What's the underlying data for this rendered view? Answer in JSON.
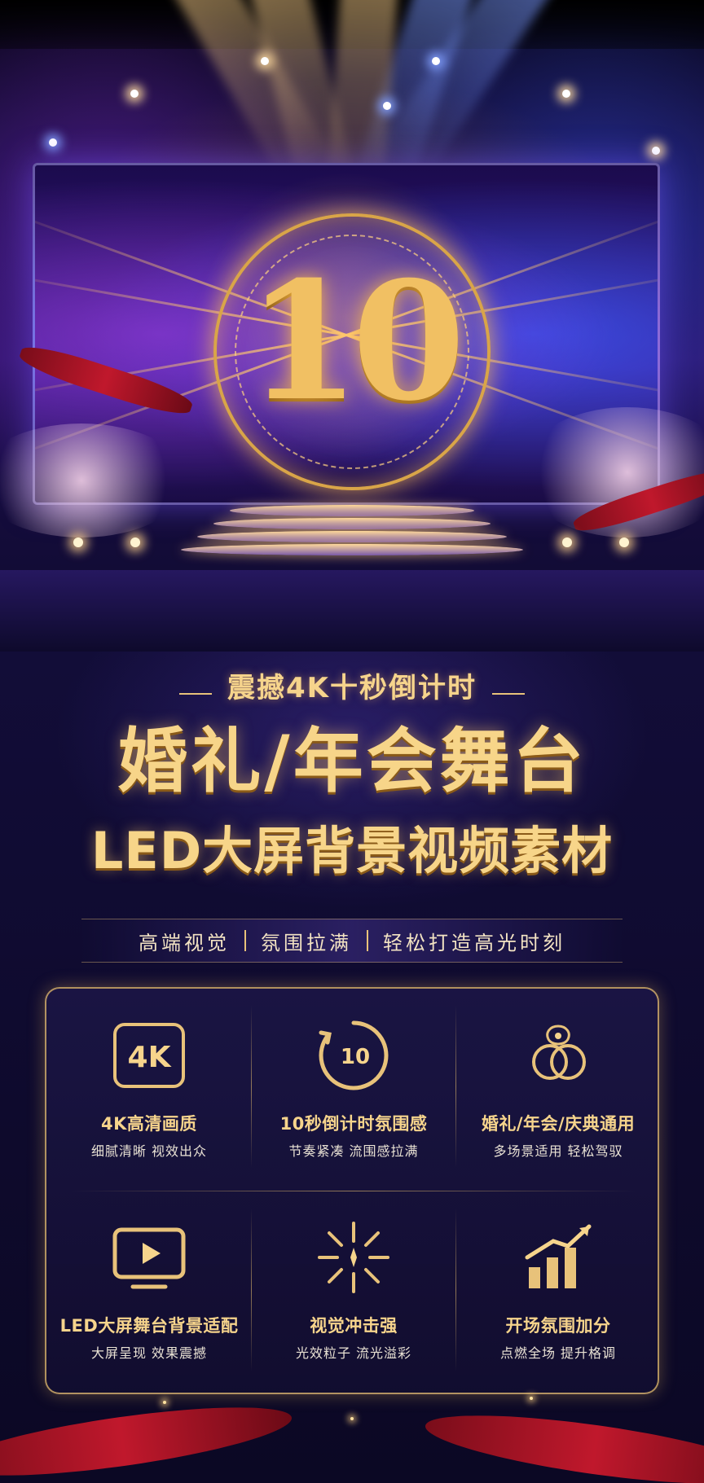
{
  "hero": {
    "countdown_number": "10"
  },
  "subtitle": "震撼4K十秒倒计时",
  "title": {
    "line1": "婚礼/年会舞台",
    "line2": "LED大屏背景视频素材"
  },
  "taglines": [
    "高端视觉",
    "氛围拉满",
    "轻松打造高光时刻"
  ],
  "features": [
    {
      "icon": "4k-badge-icon",
      "icon_text": "4K",
      "title": "4K高清画质",
      "desc": "细腻清晰 视效出众"
    },
    {
      "icon": "countdown-timer-icon",
      "icon_text": "10",
      "title": "10秒倒计时氛围感",
      "desc": "节奏紧凑 流围感拉满"
    },
    {
      "icon": "rings-icon",
      "icon_text": "",
      "title": "婚礼/年会/庆典通用",
      "desc": "多场景适用 轻松驾驭"
    },
    {
      "icon": "led-screen-play-icon",
      "icon_text": "",
      "title": "LED大屏舞台背景适配",
      "desc": "大屏呈现 效果震撼"
    },
    {
      "icon": "burst-icon",
      "icon_text": "",
      "title": "视觉冲击强",
      "desc": "光效粒子 流光溢彩"
    },
    {
      "icon": "growth-chart-icon",
      "icon_text": "",
      "title": "开场氛围加分",
      "desc": "点燃全场 提升格调"
    }
  ],
  "colors": {
    "gold": "#f6d48c",
    "deep_gold": "#d9a548",
    "background": "#0e0a2c",
    "ribbon_red": "#c0182c"
  }
}
